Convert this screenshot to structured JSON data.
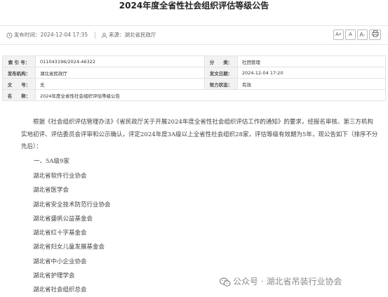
{
  "page": {
    "title": "2024年度全省性社会组织评估等级公告"
  },
  "meta": {
    "publish_time_label": "发布时间：",
    "publish_time_value": "2024-12-04 17:35",
    "source_label": "来源：",
    "source_value": "湖北省民政厅",
    "font_sizes": [
      "A+",
      "A",
      "A-"
    ]
  },
  "info_table": {
    "rows": [
      {
        "label1": "索 引 号：",
        "value1": "011043196/2024-46322",
        "label2": "分　　类：",
        "value2": "社团管理"
      },
      {
        "label1": "发布机构：",
        "value1": "湖北省民政厅",
        "label2": "发文日期：",
        "value2": "2024-12-04 17:20"
      },
      {
        "label1": "文　　号：",
        "value1": "无",
        "label2": "效力状态：",
        "value2": "有效"
      }
    ],
    "name_label": "名　　称：",
    "name_value": "2024年度全省性社会组织评估等级公告"
  },
  "body": {
    "intro": "根据《社会组织评估管理办法》《省民政厅关于开展2024年度全省性社会组织评估工作的通知》的要求，经报名审核、第三方机构实地初评、评估委员会评审和公示确认，评定2024年度3A级以上全省性社会组织28家，评估等级有效期为5年，现公告如下（排序不分先后）：",
    "section_heading": "一、5A级9家",
    "orgs": [
      "湖北省软件行业协会",
      "湖北省医学会",
      "湖北省安全技术防范行业协会",
      "湖北省盛帆公益基金会",
      "湖北省红十字基金会",
      "湖北省妇女儿童发展基金会",
      "湖北省中小企业协会",
      "湖北省护理学会",
      "湖北省社会组织总会"
    ]
  },
  "watermark": {
    "text": "公众号 · 湖北省吊装行业协会"
  }
}
